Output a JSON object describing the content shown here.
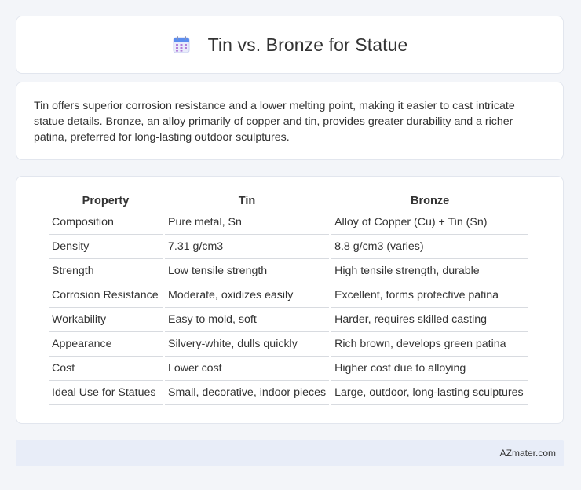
{
  "header": {
    "title": "Tin vs. Bronze for Statue",
    "icon": "calendar-icon"
  },
  "summary": "Tin offers superior corrosion resistance and a lower melting point, making it easier to cast intricate statue details. Bronze, an alloy primarily of copper and tin, provides greater durability and a richer patina, preferred for long-lasting outdoor sculptures.",
  "table": {
    "headers": [
      "Property",
      "Tin",
      "Bronze"
    ],
    "rows": [
      [
        "Composition",
        "Pure metal, Sn",
        "Alloy of Copper (Cu) + Tin (Sn)"
      ],
      [
        "Density",
        "7.31 g/cm3",
        "8.8 g/cm3 (varies)"
      ],
      [
        "Strength",
        "Low tensile strength",
        "High tensile strength, durable"
      ],
      [
        "Corrosion Resistance",
        "Moderate, oxidizes easily",
        "Excellent, forms protective patina"
      ],
      [
        "Workability",
        "Easy to mold, soft",
        "Harder, requires skilled casting"
      ],
      [
        "Appearance",
        "Silvery-white, dulls quickly",
        "Rich brown, develops green patina"
      ],
      [
        "Cost",
        "Lower cost",
        "Higher cost due to alloying"
      ],
      [
        "Ideal Use for Statues",
        "Small, decorative, indoor pieces",
        "Large, outdoor, long-lasting sculptures"
      ]
    ]
  },
  "footer": {
    "site": "AZmater.com"
  },
  "colors": {
    "page_bg": "#f3f5f9",
    "card_bg": "#ffffff",
    "footer_bg": "#e8edf8",
    "icon_accent": "#5b8def"
  }
}
